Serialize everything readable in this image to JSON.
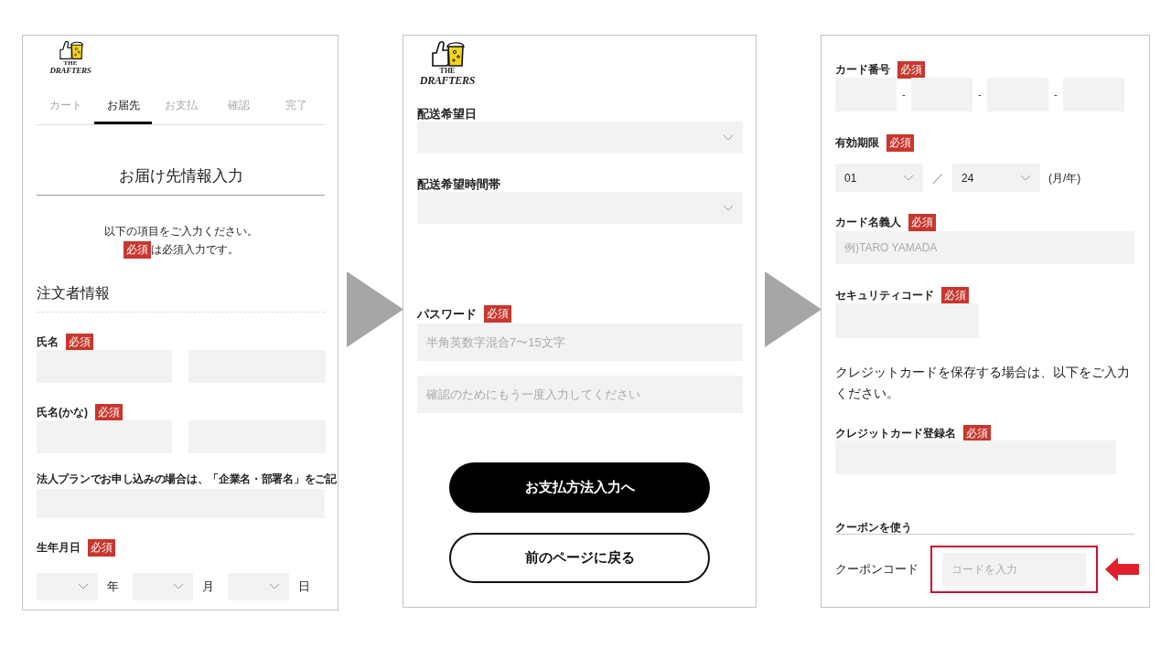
{
  "screen_1": {
    "logo": {
      "top": "THE",
      "name": "DRAFTERS"
    },
    "steps": [
      {
        "label": "カート",
        "selected": false
      },
      {
        "label": "お届先",
        "selected": true
      },
      {
        "label": "お支払",
        "selected": false
      },
      {
        "label": "確認",
        "selected": false
      },
      {
        "label": "完了",
        "selected": false
      }
    ],
    "title": "お届け先情報入力",
    "intro": "以下の項目をご入力ください。",
    "legend": {
      "badge": "必須",
      "text": "は必須入力です。"
    },
    "section_title": "注文者情報",
    "fields": [
      {
        "kind": "pair",
        "label": "氏名",
        "badge": "必須"
      },
      {
        "kind": "pair",
        "label": "氏名(かな)",
        "badge": "必須"
      },
      {
        "kind": "single",
        "label": "法人プランでお申し込みの場合は、「企業名・部署名」をご記"
      },
      {
        "kind": "date",
        "label": "生年月日",
        "badge": "必須",
        "units": [
          "年",
          "月",
          "日"
        ]
      }
    ]
  },
  "screen_2": {
    "logo": {
      "top": "THE",
      "name": "DRAFTERS"
    },
    "fields": [
      {
        "kind": "select",
        "label": "配送希望日"
      },
      {
        "kind": "select",
        "label": "配送希望時間帯"
      },
      {
        "kind": "password",
        "label": "パスワード",
        "badge": "必須",
        "placeholders": [
          "半角英数字混合7〜15文字",
          "確認のためにもう一度入力してください"
        ]
      }
    ],
    "buttons": [
      {
        "kind": "primary",
        "label": "お支払方法入力へ"
      },
      {
        "kind": "secondary",
        "label": "前のページに戻る"
      }
    ]
  },
  "screen_3": {
    "fields": [
      {
        "kind": "card_number",
        "label": "カード番号",
        "badge": "必須",
        "separators": [
          "-",
          "-",
          "-"
        ]
      },
      {
        "kind": "expiry",
        "label": "有効期限",
        "badge": "必須",
        "month": "01",
        "separator": "／",
        "year": "24",
        "unit": "(月/年)"
      },
      {
        "kind": "text",
        "label": "カード名義人",
        "badge": "必須",
        "placeholder": "例)TARO YAMADA"
      },
      {
        "kind": "short",
        "label": "セキュリティコード",
        "badge": "必須"
      },
      {
        "kind": "note",
        "text": "クレジットカードを保存する場合は、以下をご入力ください。"
      },
      {
        "kind": "medium",
        "label": "クレジットカード登録名",
        "badge": "必須"
      }
    ],
    "coupon": {
      "title": "クーポンを使う",
      "label": "クーポンコード",
      "placeholder": "コードを入力",
      "highlighted": true
    }
  }
}
